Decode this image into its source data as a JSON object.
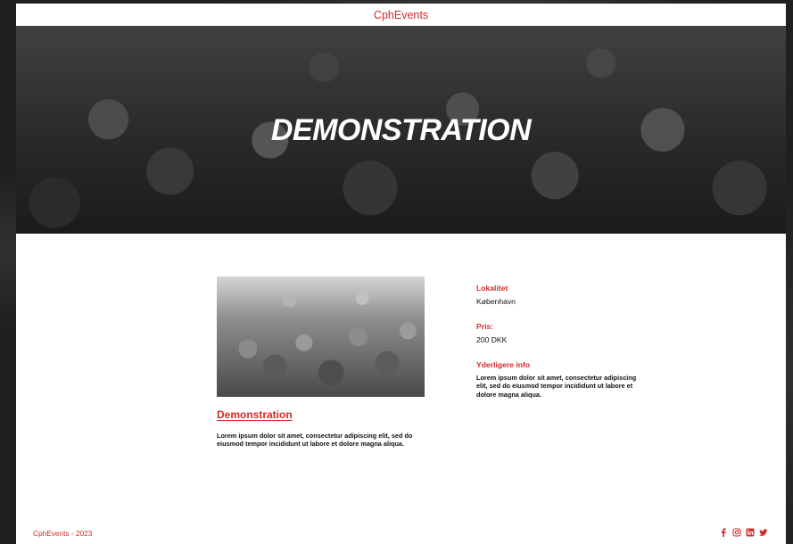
{
  "header": {
    "brand": "CphEvents"
  },
  "hero": {
    "title": "DEMONSTRATION"
  },
  "event": {
    "title": "Demonstration",
    "description": "Lorem ipsum dolor sit amet, consectetur adipiscing elit, sed do eiusmod tempor incididunt ut labore et dolore magna aliqua."
  },
  "details": {
    "location_label": "Lokalitet",
    "location_value": "København",
    "price_label": "Pris:",
    "price_value": "200 DKK",
    "more_label": "Yderligere info",
    "more_value": "Lorem ipsum dolor sit amet, consectetur adipiscing elit, sed do eiusmod tempor incididunt ut labore et dolore magna aliqua."
  },
  "footer": {
    "copyright": "CphEvents - 2023",
    "social_icons": [
      "facebook-icon",
      "instagram-icon",
      "linkedin-icon",
      "twitter-icon"
    ]
  },
  "colors": {
    "accent": "#d42a2a",
    "background": "#202020",
    "page": "#ffffff"
  }
}
